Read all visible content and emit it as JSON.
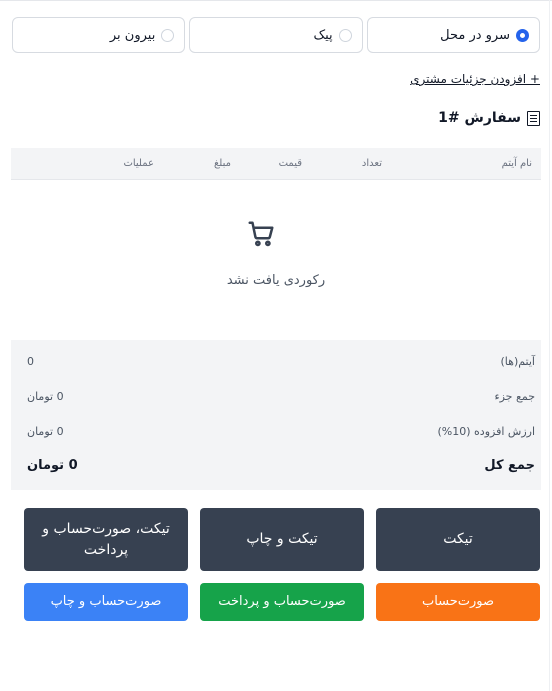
{
  "order_types": [
    {
      "label": "سرو در محل",
      "checked": true
    },
    {
      "label": "پیک",
      "checked": false
    },
    {
      "label": "بیرون بر",
      "checked": false
    }
  ],
  "add_customer_label": "+ افزودن جزئیات مشتری",
  "order_title": "سفارش #1",
  "table": {
    "headers": {
      "name": "نام آیتم",
      "qty": "تعداد",
      "price": "قیمت",
      "amount": "مبلغ",
      "ops": "عملیات"
    },
    "empty_text": "رکوردی یافت نشد"
  },
  "summary": {
    "items_label": "آیتم(ها)",
    "items_value": "0",
    "subtotal_label": "جمع جزء",
    "subtotal_value": "0 تومان",
    "vat_label": "ارزش افزوده (10%)",
    "vat_value": "0 تومان",
    "total_label": "جمع کل",
    "total_value": "0 تومان"
  },
  "buttons": {
    "ticket": "تیکت",
    "ticket_print": "تیکت و چاپ",
    "ticket_bill_pay": "تیکت، صورت‌حساب و پرداخت",
    "bill": "صورت‌حساب",
    "bill_pay": "صورت‌حساب و پرداخت",
    "bill_print": "صورت‌حساب و چاپ"
  },
  "colors": {
    "accent": "#2563eb",
    "dark_button": "#374151",
    "orange_button": "#f97316",
    "green_button": "#16a34a",
    "blue_button": "#3b82f6"
  }
}
